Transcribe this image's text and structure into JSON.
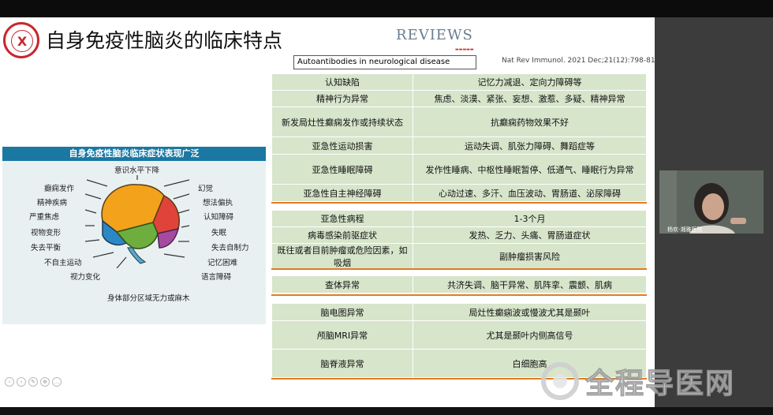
{
  "slide": {
    "logo_char": "X",
    "title": "自身免疫性脑炎的临床特点",
    "reviews": "REVIEWS",
    "subtitle": "Autoantibodies in neurological disease",
    "citation": "Nat Rev Immunol. 2021 Dec;21(12):798-813."
  },
  "panel": {
    "header": "自身免疫性脑炎临床症状表现广泛",
    "labels": {
      "top": "意识水平下降",
      "seizure": "癫痫发作",
      "psychosis": "精神疾病",
      "anxiety": "严重焦虑",
      "visual_distortion": "视物变形",
      "balance": "失去平衡",
      "involuntary": "不自主运动",
      "vision_change": "视力变化",
      "hallucination": "幻觉",
      "paranoid": "想法偏执",
      "cognitive": "认知障碍",
      "insomnia": "失眠",
      "self_control": "失去自制力",
      "memory": "记忆困难",
      "language": "语言障碍",
      "bottom": "身体部分区域无力或麻木"
    }
  },
  "tables": {
    "group1": [
      {
        "left": "认知缺陷",
        "right": "记忆力减退、定向力障碍等"
      },
      {
        "left": "精神行为异常",
        "right": "焦虑、淡漠、紧张、妄想、激惹、多疑、精神异常"
      },
      {
        "left": "新发局灶性癫痫发作或持续状态",
        "right": "抗癫痫药物效果不好"
      },
      {
        "left": "亚急性运动损害",
        "right": "运动失调、肌张力障碍、舞蹈症等"
      },
      {
        "left": "亚急性睡眠障碍",
        "right": "发作性睡病、中枢性睡眠暂停、低通气、睡眠行为异常"
      },
      {
        "left": "亚急性自主神经障碍",
        "right": "心动过速、多汗、血压波动、胃肠道、泌尿障碍"
      }
    ],
    "group2": [
      {
        "left": "亚急性病程",
        "right": "1-3个月"
      },
      {
        "left": "病毒感染前驱症状",
        "right": "发热、乏力、头痛、胃肠道症状"
      },
      {
        "left": "既往或者目前肿瘤或危险因素，如吸烟",
        "right": "副肿瘤损害风险"
      }
    ],
    "group3": [
      {
        "left": "查体异常",
        "right": "共济失调、脑干异常、肌阵挛、震颤、肌病"
      }
    ],
    "group4": [
      {
        "left": "脑电图异常",
        "right": "局灶性癫痫波或慢波尤其是颞叶"
      },
      {
        "left": "颅脑MRI异常",
        "right": "尤其是颞叶内侧高信号"
      },
      {
        "left": "脑脊液异常",
        "right": "白细胞高"
      }
    ]
  },
  "webcam": {
    "label": "杨欢-湘雅医院"
  },
  "watermark": {
    "text": "全程导医网"
  },
  "colors": {
    "table_fill": "#d7e5cb",
    "separator": "#e07b26",
    "panel_header": "#1a78a3",
    "logo_red": "#c8272d"
  }
}
